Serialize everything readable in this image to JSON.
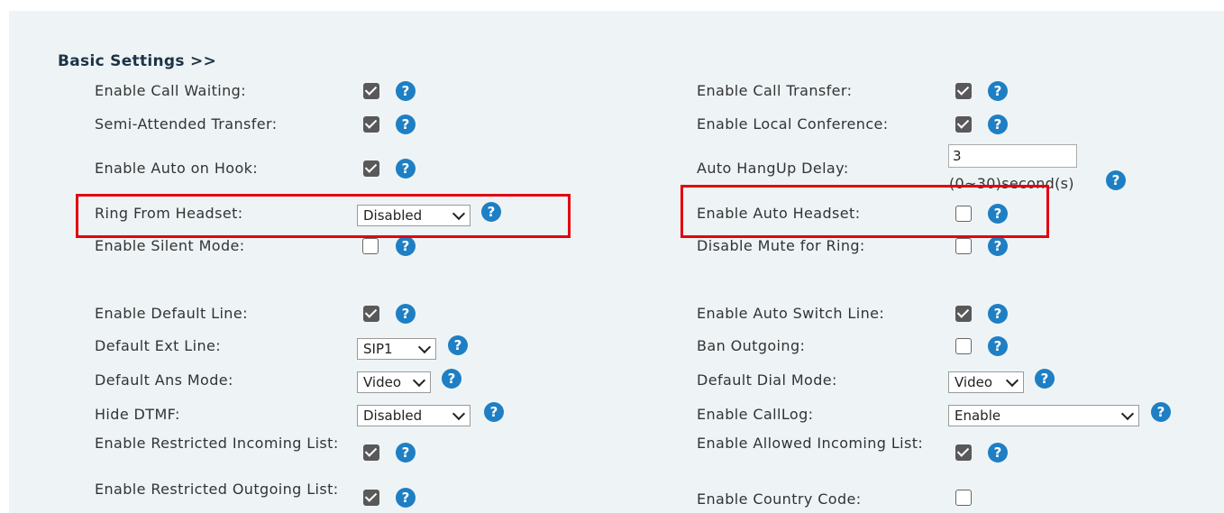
{
  "section_title": "Basic Settings >>",
  "help_glyph": "?",
  "left": {
    "call_waiting": {
      "label": "Enable Call Waiting:",
      "checked": true
    },
    "semi_attended": {
      "label": "Semi-Attended Transfer:",
      "checked": true
    },
    "auto_on_hook": {
      "label": "Enable Auto on Hook:",
      "checked": true
    },
    "ring_from_headset": {
      "label": "Ring From Headset:",
      "value": "Disabled"
    },
    "silent_mode": {
      "label": "Enable Silent Mode:",
      "checked": false
    },
    "default_line": {
      "label": "Enable Default Line:",
      "checked": true
    },
    "default_ext_line": {
      "label": "Default Ext Line:",
      "value": "SIP1"
    },
    "default_ans_mode": {
      "label": "Default Ans Mode:",
      "value": "Video"
    },
    "hide_dtmf": {
      "label": "Hide DTMF:",
      "value": "Disabled"
    },
    "restricted_incoming": {
      "label": "Enable Restricted Incoming List:",
      "checked": true
    },
    "restricted_outgoing": {
      "label": "Enable Restricted Outgoing List:",
      "checked": true
    }
  },
  "right": {
    "call_transfer": {
      "label": "Enable Call Transfer:",
      "checked": true
    },
    "local_conference": {
      "label": "Enable Local Conference:",
      "checked": true
    },
    "auto_hangup_delay": {
      "label": "Auto HangUp Delay:",
      "value": "3",
      "hint": "(0~30)second(s)"
    },
    "auto_headset": {
      "label": "Enable Auto Headset:",
      "checked": false
    },
    "disable_mute_ring": {
      "label": "Disable Mute for Ring:",
      "checked": false
    },
    "auto_switch_line": {
      "label": "Enable Auto Switch Line:",
      "checked": true
    },
    "ban_outgoing": {
      "label": "Ban Outgoing:",
      "checked": false
    },
    "default_dial_mode": {
      "label": "Default Dial Mode:",
      "value": "Video"
    },
    "calllog": {
      "label": "Enable CallLog:",
      "value": "Enable"
    },
    "allowed_incoming": {
      "label": "Enable Allowed Incoming List:",
      "checked": true
    },
    "country_code": {
      "label": "Enable Country Code:",
      "checked": false
    }
  },
  "colors": {
    "highlight": "#e3000f",
    "help": "#1e7fc4",
    "panel": "#eef4f6"
  }
}
